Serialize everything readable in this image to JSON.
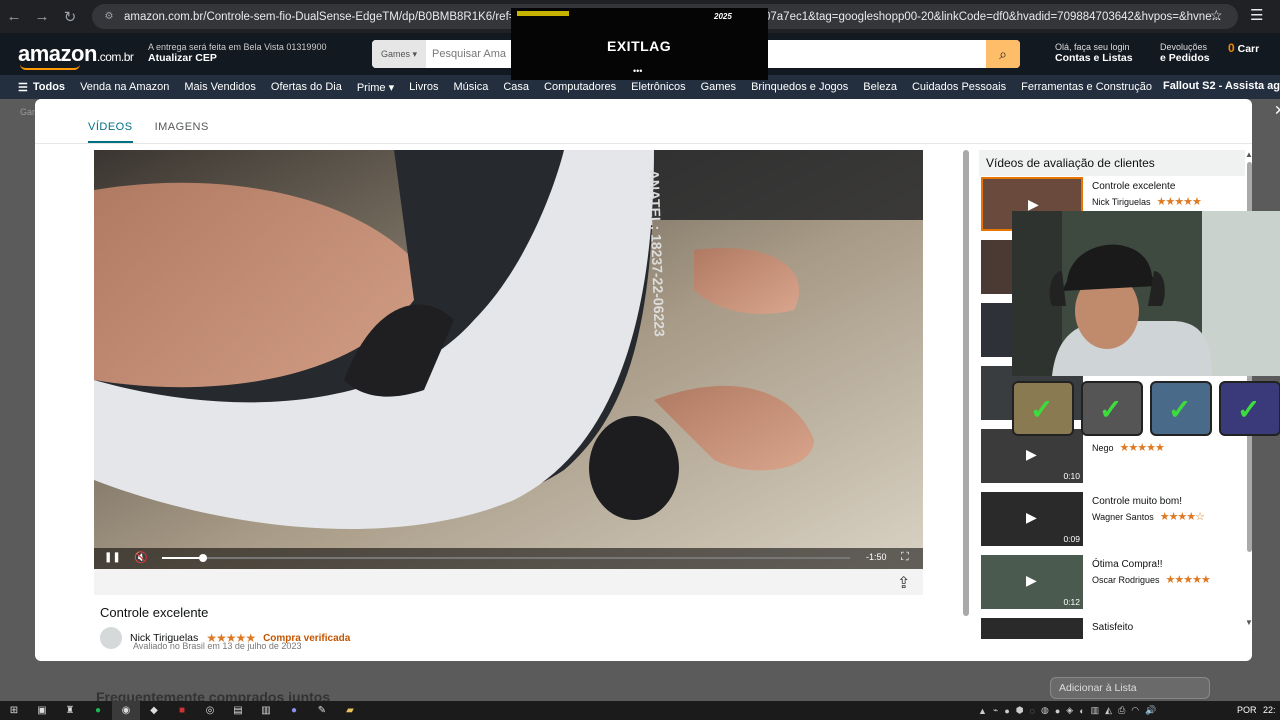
{
  "browser": {
    "url": "amazon.com.br/Controle-sem-fio-DualSense-EdgeTM/dp/B0BMB8R1K6/ref=asc_d",
    "url_tail": "07a7ec1&tag=googleshopp00-20&linkCode=df0&hvadid=709884703642&hvpos=&hvne..."
  },
  "amazon": {
    "logo": "amazon",
    "logo_suffix": ".com.br",
    "deliver_line1": "A entrega será feita em Bela Vista 01319900",
    "deliver_line2": "Atualizar CEP",
    "search_category": "Games",
    "search_placeholder": "Pesquisar Ama",
    "account_line1": "Olá, faça seu login",
    "account_line2": "Contas e Listas",
    "returns_line1": "Devoluções",
    "returns_line2": "e Pedidos",
    "cart_count": "0",
    "cart_label": "Carr"
  },
  "nav": {
    "all": "Todos",
    "items": [
      "Venda na Amazon",
      "Mais Vendidos",
      "Ofertas do Dia",
      "Prime",
      "Livros",
      "Música",
      "Casa",
      "Computadores",
      "Eletrônicos",
      "Games",
      "Brinquedos e Jogos",
      "Beleza",
      "Cuidados Pessoais",
      "Ferramentas e Construção"
    ],
    "promo": "Fallout S2 - Assista ag"
  },
  "background": {
    "crumb": "Gar",
    "list_button": "Adicionar à Lista",
    "bottom_heading": "Frequentemente comprados juntos"
  },
  "modal": {
    "tabs": [
      "VÍDEOS",
      "IMAGENS"
    ],
    "active_tab": 0,
    "player": {
      "progress": 0.06,
      "time_remaining": "-1:50"
    },
    "review": {
      "title": "Controle excelente",
      "reviewer": "Nick Tiriguelas",
      "stars": "★★★★★",
      "verified": "Compra verificada",
      "date": "Avaliado no Brasil em 13 de julho de 2023"
    },
    "sidebar": {
      "heading": "Vídeos de avaliação de clientes",
      "items": [
        {
          "title": "Controle excelente",
          "author": "Nick Tiriguelas",
          "stars": "★★★★★",
          "duration": ""
        },
        {
          "title": "",
          "author": "",
          "stars": "",
          "duration": ""
        },
        {
          "title": "",
          "author": "",
          "stars": "",
          "duration": ""
        },
        {
          "title": "",
          "author": "",
          "stars": "",
          "duration": ""
        },
        {
          "title": "",
          "author": "Nego",
          "stars": "★★★★★",
          "duration": "0:10"
        },
        {
          "title": "Controle muito bom!",
          "author": "Wagner Santos",
          "stars": "★★★★☆",
          "duration": "0:09"
        },
        {
          "title": "Ótima Compra!!",
          "author": "Oscar Rodrigues",
          "stars": "★★★★★",
          "duration": "0:12"
        },
        {
          "title": "Satisfeito",
          "author": "",
          "stars": "",
          "duration": ""
        }
      ]
    }
  },
  "overlays": {
    "exitlag": "EXITLAG",
    "exitlag_corner": "2025",
    "exitlag_dots": "•••"
  },
  "taskbar": {
    "lang": "POR",
    "clock": "22:"
  },
  "colors": {
    "amazon_dark": "#131921",
    "amazon_nav": "#232f3e",
    "accent_orange": "#ff9900",
    "star_color": "#de7921",
    "link_teal": "#007185"
  }
}
